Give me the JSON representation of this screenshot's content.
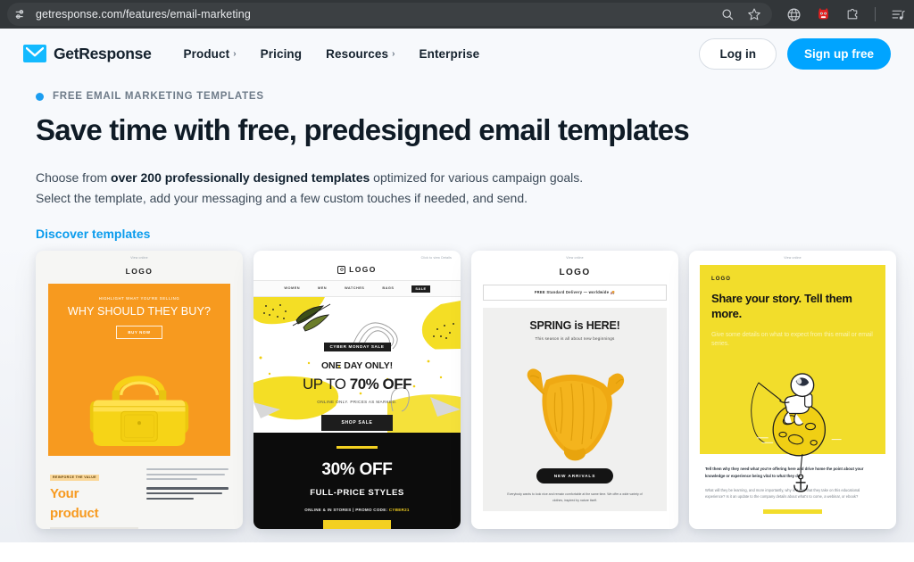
{
  "browser": {
    "url": "getresponse.com/features/email-marketing",
    "left_icon": "page-settings-icon",
    "icons": [
      "search-icon",
      "bookmark-star-icon",
      "globe-icon",
      "red-mascot-extension-icon",
      "extensions-puzzle-icon",
      "reading-list-icon"
    ]
  },
  "header": {
    "brand": "GetResponse",
    "nav": [
      {
        "label": "Product",
        "caret": "›"
      },
      {
        "label": "Pricing",
        "caret": ""
      },
      {
        "label": "Resources",
        "caret": "›"
      },
      {
        "label": "Enterprise",
        "caret": ""
      }
    ],
    "login_label": "Log in",
    "signup_label": "Sign up free",
    "accent": "#00a4ff"
  },
  "hero": {
    "eyebrow": "FREE EMAIL MARKETING TEMPLATES",
    "title": "Save time with free, predesigned email templates",
    "paragraph_prefix": "Choose from ",
    "paragraph_bold": "over 200 professionally designed templates",
    "paragraph_suffix": " optimized for various campaign goals.",
    "paragraph_line2": "Select the template, add your messaging and a few custom touches if needed, and send.",
    "link": "Discover templates"
  },
  "templates": [
    {
      "name": "product-promo-template",
      "view_online": "View online",
      "logo": "LOGO",
      "kicker": "HIGHLIGHT WHAT YOU'RE SELLING",
      "headline": "WHY SHOULD THEY BUY?",
      "button": "BUY NOW",
      "image": "yellow-handbag",
      "tag": "REINFORCE THE VALUE",
      "big_line1": "Your",
      "big_line2": "product"
    },
    {
      "name": "cyber-monday-sale-template",
      "view_online": "Click to view Details",
      "logo": "LOGO",
      "nav": [
        "WOMEN",
        "MEN",
        "WATCHES",
        "BAGS"
      ],
      "nav_sale": "SALE",
      "badge": "CYBER MONDAY SALE",
      "line1": "ONE DAY ONLY!",
      "line2_thin": "UP TO ",
      "line2_bold": "70% OFF",
      "sub": "ONLINE ONLY. PRICES AS MARKED.",
      "button": "SHOP SALE",
      "dark_headline": "30% OFF",
      "dark_sub": "FULL-PRICE STYLES",
      "promo_prefix": "ONLINE & IN STORES | PROMO CODE: ",
      "promo_code": "CYBER21"
    },
    {
      "name": "spring-arrivals-template",
      "view_online": "View online",
      "logo": "LOGO",
      "delivery_bar": "FREE Standard Delivery — worldwide 🚚",
      "headline_a": "SPRING ",
      "headline_b": "is",
      "headline_c": " HERE!",
      "sub": "This season is all about new beginnings",
      "image": "yellow-knit-sweater",
      "button": "NEW ARRIVALS",
      "footer": "Everybody wants to look nice and remain comfortable at the same time. We offer a wide variety of clothes, inspired by nature itself."
    },
    {
      "name": "share-your-story-template",
      "view_online": "View online",
      "logo": "LOGO",
      "headline": "Share your story. Tell them more.",
      "sub": "Give some details on what to expect from this email or email series.",
      "image": "astronaut-fishing-on-moon",
      "body1": "Tell them why they need what you're offering here and drive home the point about your knowledge or experience being vital to what they do.",
      "body2": "What will they be learning, and more importantly, why is it vital that they take on this educational experience? Is it an update to the company details about what's to come, a webinar, or ebook?"
    }
  ]
}
